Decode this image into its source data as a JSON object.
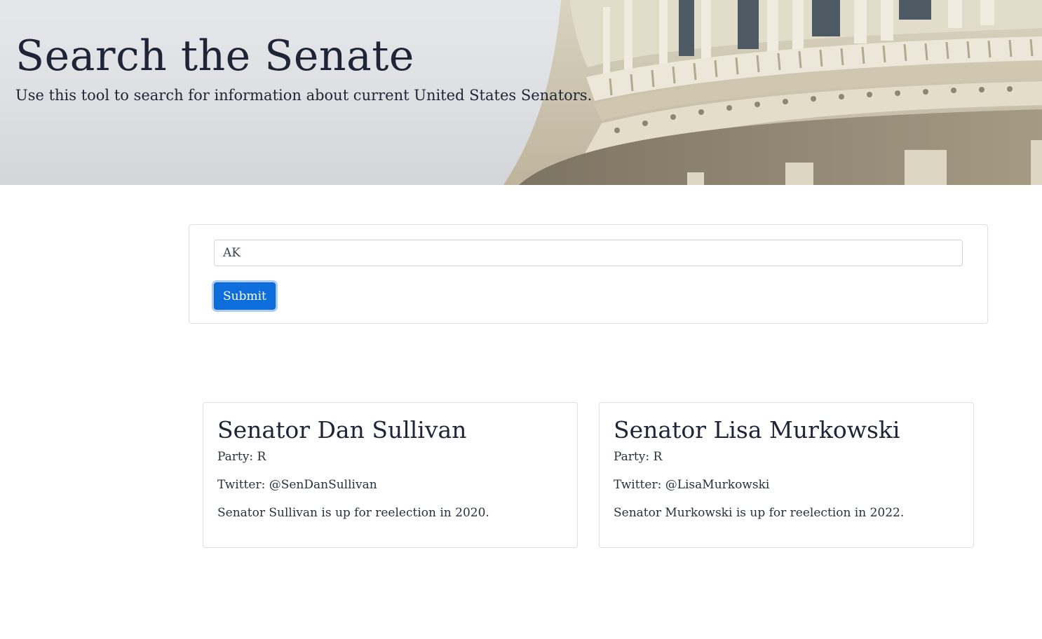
{
  "hero": {
    "title": "Search the Senate",
    "subtitle": "Use this tool to search for information about current United States Senators."
  },
  "search": {
    "value": "AK",
    "submit_label": "Submit"
  },
  "results": [
    {
      "name": "Senator Dan Sullivan",
      "party": "Party: R",
      "twitter": "Twitter: @SenDanSullivan",
      "reelection": "Senator Sullivan is up for reelection in 2020."
    },
    {
      "name": "Senator Lisa Murkowski",
      "party": "Party: R",
      "twitter": "Twitter: @LisaMurkowski",
      "reelection": "Senator Murkowski is up for reelection in 2022."
    }
  ],
  "colors": {
    "primary_button": "#0d6edc",
    "text": "#1f2536",
    "border": "#dcdfe3"
  }
}
